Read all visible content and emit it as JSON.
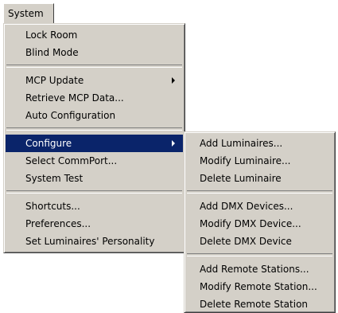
{
  "menubar": {
    "system_label": "System"
  },
  "main_menu": {
    "lock_room": "Lock Room",
    "blind_mode": "Blind Mode",
    "mcp_update": "MCP Update",
    "retrieve_mcp_data": "Retrieve MCP Data...",
    "auto_configuration": "Auto Configuration",
    "configure": "Configure",
    "select_commport": "Select CommPort...",
    "system_test": "System Test",
    "shortcuts": "Shortcuts...",
    "preferences": "Preferences...",
    "set_luminaires_personality": "Set Luminaires' Personality"
  },
  "configure_submenu": {
    "add_luminaires": "Add Luminaires...",
    "modify_luminaire": "Modify Luminaire...",
    "delete_luminaire": "Delete Luminaire",
    "add_dmx_devices": "Add DMX Devices...",
    "modify_dmx_device": "Modify DMX Device...",
    "delete_dmx_device": "Delete DMX Device",
    "add_remote_stations": "Add Remote Stations...",
    "modify_remote_station": "Modify Remote Station...",
    "delete_remote_station": "Delete Remote Station"
  },
  "colors": {
    "menu_face": "#d4d0c8",
    "highlight": "#0a246a",
    "highlight_text": "#ffffff"
  },
  "icons": {
    "submenu_arrow": "chevron-right-icon"
  },
  "state": {
    "highlighted_item": "Configure",
    "open_submenu": "Configure"
  }
}
